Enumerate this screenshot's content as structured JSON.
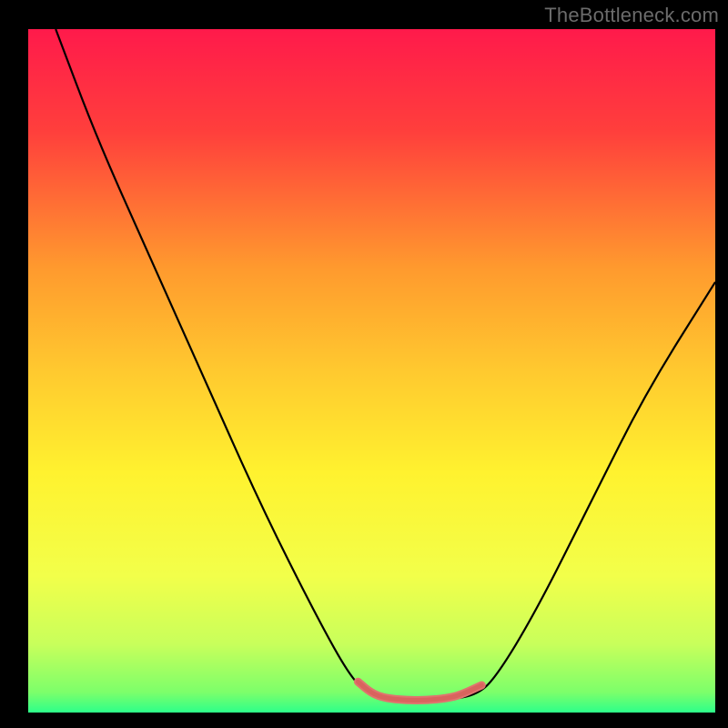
{
  "watermark": "TheBottleneck.com",
  "chart_data": {
    "type": "line",
    "title": "",
    "xlabel": "",
    "ylabel": "",
    "xlim": [
      0,
      100
    ],
    "ylim": [
      0,
      100
    ],
    "background_gradient": {
      "stops": [
        {
          "offset": 0.0,
          "color": "#ff1a4b"
        },
        {
          "offset": 0.15,
          "color": "#ff3f3c"
        },
        {
          "offset": 0.35,
          "color": "#ff9a2e"
        },
        {
          "offset": 0.5,
          "color": "#ffc92f"
        },
        {
          "offset": 0.65,
          "color": "#fff22f"
        },
        {
          "offset": 0.8,
          "color": "#f2ff4a"
        },
        {
          "offset": 0.9,
          "color": "#c8ff5b"
        },
        {
          "offset": 0.97,
          "color": "#7dff6a"
        },
        {
          "offset": 1.0,
          "color": "#2dff8a"
        }
      ]
    },
    "series": [
      {
        "name": "bottleneck-curve",
        "style": "thin-black",
        "points": [
          {
            "x": 4,
            "y": 100
          },
          {
            "x": 10,
            "y": 84
          },
          {
            "x": 18,
            "y": 66
          },
          {
            "x": 26,
            "y": 48
          },
          {
            "x": 34,
            "y": 30
          },
          {
            "x": 42,
            "y": 14
          },
          {
            "x": 47,
            "y": 5
          },
          {
            "x": 50,
            "y": 2.4
          },
          {
            "x": 55,
            "y": 1.8
          },
          {
            "x": 60,
            "y": 1.8
          },
          {
            "x": 65,
            "y": 2.4
          },
          {
            "x": 68,
            "y": 5
          },
          {
            "x": 74,
            "y": 15
          },
          {
            "x": 82,
            "y": 31
          },
          {
            "x": 90,
            "y": 47
          },
          {
            "x": 100,
            "y": 63
          }
        ]
      },
      {
        "name": "valley-highlight",
        "style": "thick-salmon",
        "points": [
          {
            "x": 48,
            "y": 4.5
          },
          {
            "x": 50,
            "y": 2.8
          },
          {
            "x": 52,
            "y": 2.1
          },
          {
            "x": 55,
            "y": 1.8
          },
          {
            "x": 58,
            "y": 1.8
          },
          {
            "x": 61,
            "y": 2.1
          },
          {
            "x": 63,
            "y": 2.6
          },
          {
            "x": 66,
            "y": 4.0
          }
        ]
      }
    ]
  }
}
